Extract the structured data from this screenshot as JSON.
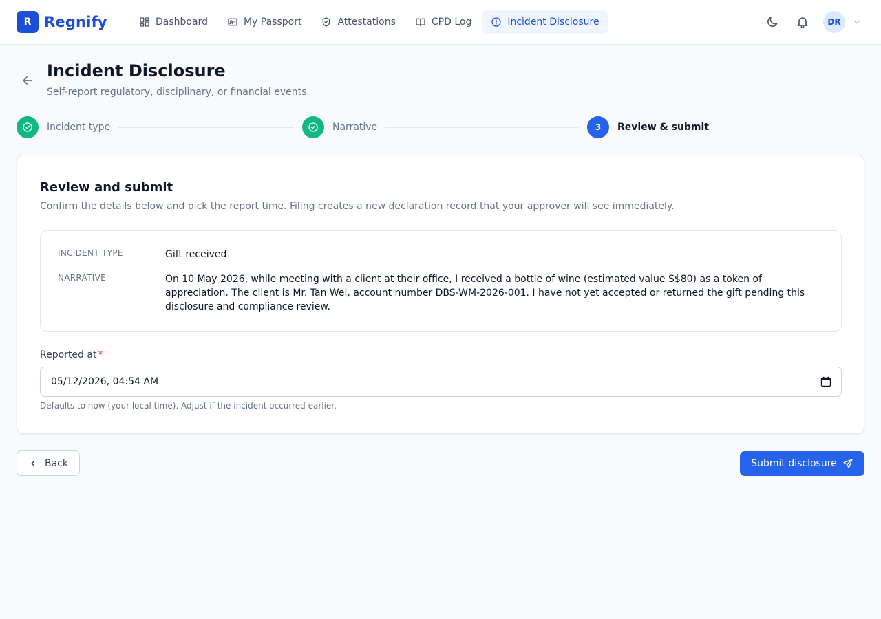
{
  "app": {
    "brand_initial": "R",
    "brand_name": "Regnify",
    "accent_color": "#2563eb",
    "brand_color": "#1d4ed8",
    "success_color": "#10b981"
  },
  "nav": {
    "items": [
      {
        "label": "Dashboard",
        "icon": "dashboard-grid-icon",
        "active": false
      },
      {
        "label": "My Passport",
        "icon": "id-card-icon",
        "active": false
      },
      {
        "label": "Attestations",
        "icon": "shield-check-icon",
        "active": false
      },
      {
        "label": "CPD Log",
        "icon": "open-book-icon",
        "active": false
      },
      {
        "label": "Incident Disclosure",
        "icon": "alert-circle-icon",
        "active": true
      }
    ]
  },
  "user": {
    "initials": "DR"
  },
  "header": {
    "title": "Incident Disclosure",
    "subtitle": "Self-report regulatory, disciplinary, or financial events."
  },
  "stepper": {
    "steps": [
      {
        "label": "Incident type",
        "status": "done",
        "number": "1"
      },
      {
        "label": "Narrative",
        "status": "done",
        "number": "2"
      },
      {
        "label": "Review & submit",
        "status": "current",
        "number": "3"
      }
    ]
  },
  "review": {
    "title": "Review and submit",
    "description": "Confirm the details below and pick the report time. Filing creates a new declaration record that your approver will see immediately.",
    "summary": {
      "incident_type_label": "INCIDENT TYPE",
      "incident_type_value": "Gift received",
      "narrative_label": "NARRATIVE",
      "narrative_value": "On 10 May 2026, while meeting with a client at their office, I received a bottle of wine (estimated value S$80) as a token of appreciation. The client is Mr. Tan Wei, account number DBS-WM-2026-001. I have not yet accepted or returned the gift pending this disclosure and compliance review."
    },
    "reported_at": {
      "label": "Reported at",
      "required_mark": "*",
      "value": "05/12/2026, 04:54 AM",
      "hint": "Defaults to now (your local time). Adjust if the incident occurred earlier."
    }
  },
  "actions": {
    "back_label": "Back",
    "submit_label": "Submit disclosure"
  }
}
